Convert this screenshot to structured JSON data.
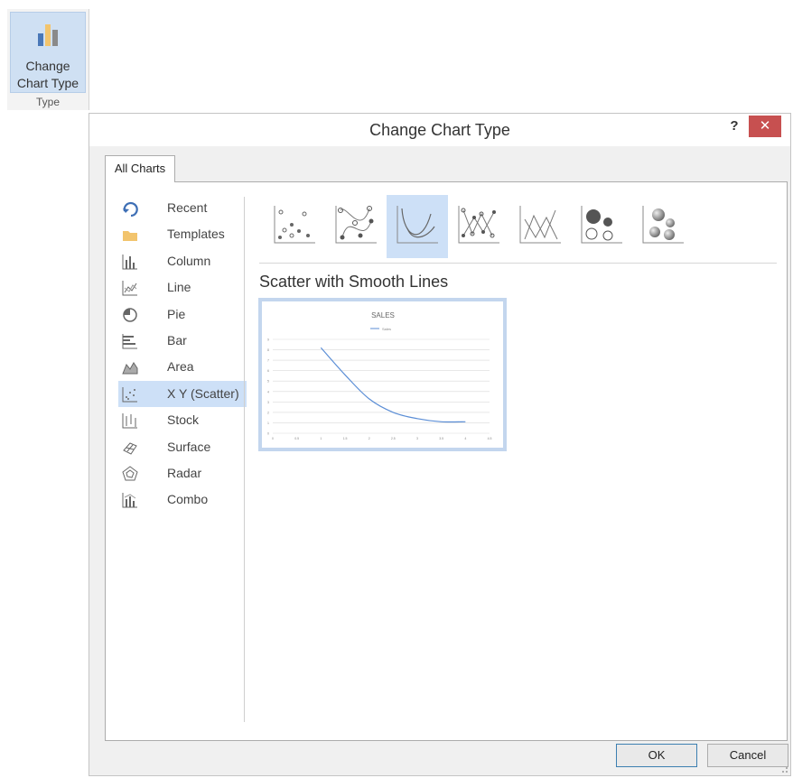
{
  "ribbon": {
    "button_line1": "Change",
    "button_line2": "Chart Type",
    "group_label": "Type"
  },
  "dialog": {
    "title": "Change Chart Type",
    "help_label": "?",
    "close_label": "✕",
    "tab_label": "All Charts",
    "categories": [
      {
        "label": "Recent",
        "icon": "recent-icon"
      },
      {
        "label": "Templates",
        "icon": "folder-icon"
      },
      {
        "label": "Column",
        "icon": "column-chart-icon"
      },
      {
        "label": "Line",
        "icon": "line-chart-icon"
      },
      {
        "label": "Pie",
        "icon": "pie-chart-icon"
      },
      {
        "label": "Bar",
        "icon": "bar-chart-icon"
      },
      {
        "label": "Area",
        "icon": "area-chart-icon"
      },
      {
        "label": "X Y (Scatter)",
        "icon": "scatter-chart-icon",
        "selected": true
      },
      {
        "label": "Stock",
        "icon": "stock-chart-icon"
      },
      {
        "label": "Surface",
        "icon": "surface-chart-icon"
      },
      {
        "label": "Radar",
        "icon": "radar-chart-icon"
      },
      {
        "label": "Combo",
        "icon": "combo-chart-icon"
      }
    ],
    "subtypes": [
      {
        "icon": "scatter-icon"
      },
      {
        "icon": "scatter-smooth-lines-markers-icon"
      },
      {
        "icon": "scatter-smooth-lines-icon",
        "selected": true
      },
      {
        "icon": "scatter-straight-lines-markers-icon"
      },
      {
        "icon": "scatter-straight-lines-icon"
      },
      {
        "icon": "bubble-icon"
      },
      {
        "icon": "bubble-3d-icon"
      }
    ],
    "selected_subtype_title": "Scatter with Smooth Lines",
    "ok_label": "OK",
    "cancel_label": "Cancel"
  },
  "colors": {
    "selection": "#cde0f7",
    "close_button": "#c75050",
    "series_line": "#5b8ed6"
  },
  "chart_data": {
    "type": "line",
    "title": "SALES",
    "series": [
      {
        "name": "Sales",
        "x": [
          1,
          1.5,
          2,
          2.5,
          3,
          3.5,
          4
        ],
        "y": [
          8.2,
          5.6,
          3.3,
          2,
          1.4,
          1.1,
          1.1
        ]
      }
    ],
    "xlim": [
      0,
      4.5
    ],
    "ylim": [
      0,
      9
    ],
    "x_ticks": [
      "0",
      "0.5",
      "1",
      "1.5",
      "2",
      "2.5",
      "3",
      "3.5",
      "4",
      "4.5"
    ],
    "y_ticks": [
      "0",
      "1",
      "2",
      "3",
      "4",
      "5",
      "6",
      "7",
      "8",
      "9"
    ],
    "grid": true,
    "legend": "top"
  }
}
